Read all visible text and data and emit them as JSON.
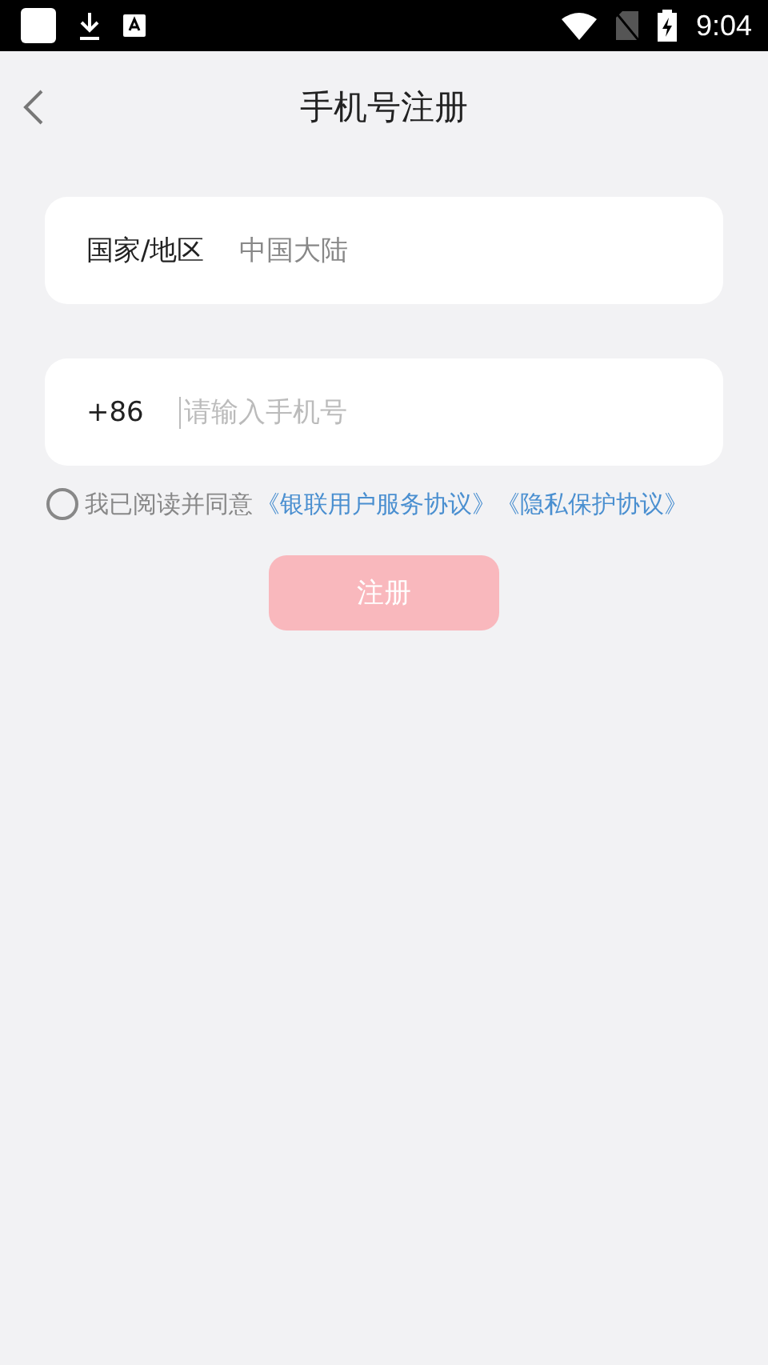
{
  "status_bar": {
    "time": "9:04"
  },
  "header": {
    "title": "手机号注册"
  },
  "region_row": {
    "label": "国家/地区",
    "value": "中国大陆"
  },
  "phone_row": {
    "prefix": "+86",
    "placeholder": "请输入手机号"
  },
  "agreement": {
    "checked": false,
    "text": "我已阅读并同意",
    "links": [
      "《银联用户服务协议》",
      "《隐私保护协议》"
    ]
  },
  "submit": {
    "label": "注册",
    "disabled": true
  }
}
